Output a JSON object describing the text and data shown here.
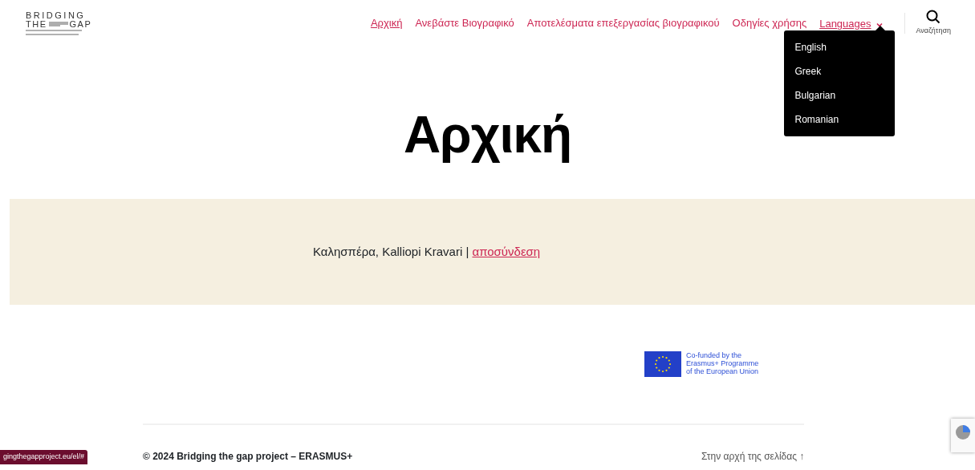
{
  "logo": {
    "line_1": "BRIDGING",
    "line_2a": "THE",
    "line_2b": "GAP"
  },
  "nav": [
    {
      "label": "Αρχική",
      "selected": true
    },
    {
      "label": "Ανεβάστε Βιογραφικό",
      "selected": false
    },
    {
      "label": "Αποτελέσματα επεξεργασίας βιογραφικού",
      "selected": false
    },
    {
      "label": "Οδηγίες χρήσης",
      "selected": false
    },
    {
      "label": "Languages",
      "expanded": true,
      "children": [
        {
          "label": "English"
        },
        {
          "label": "Greek"
        },
        {
          "label": "Bulgarian"
        },
        {
          "label": "Romanian"
        }
      ]
    }
  ],
  "search": {
    "label": "Αναζήτηση"
  },
  "page_title": "Αρχική",
  "greeting": {
    "text": "Καλησπέρα, Kalliopi Kravari |",
    "link": "αποσύνδεση"
  },
  "funding": {
    "lines": [
      "Co-funded by the",
      "Erasmus+ Programme",
      "of the European Union"
    ]
  },
  "footer": {
    "copyright": "© 2024 Bridging the gap project – ERASMUS+",
    "to_top": "Στην αρχή της σελίδας ↑"
  },
  "status_bar": {
    "url": "gingthegapproject.eu/el/#"
  }
}
